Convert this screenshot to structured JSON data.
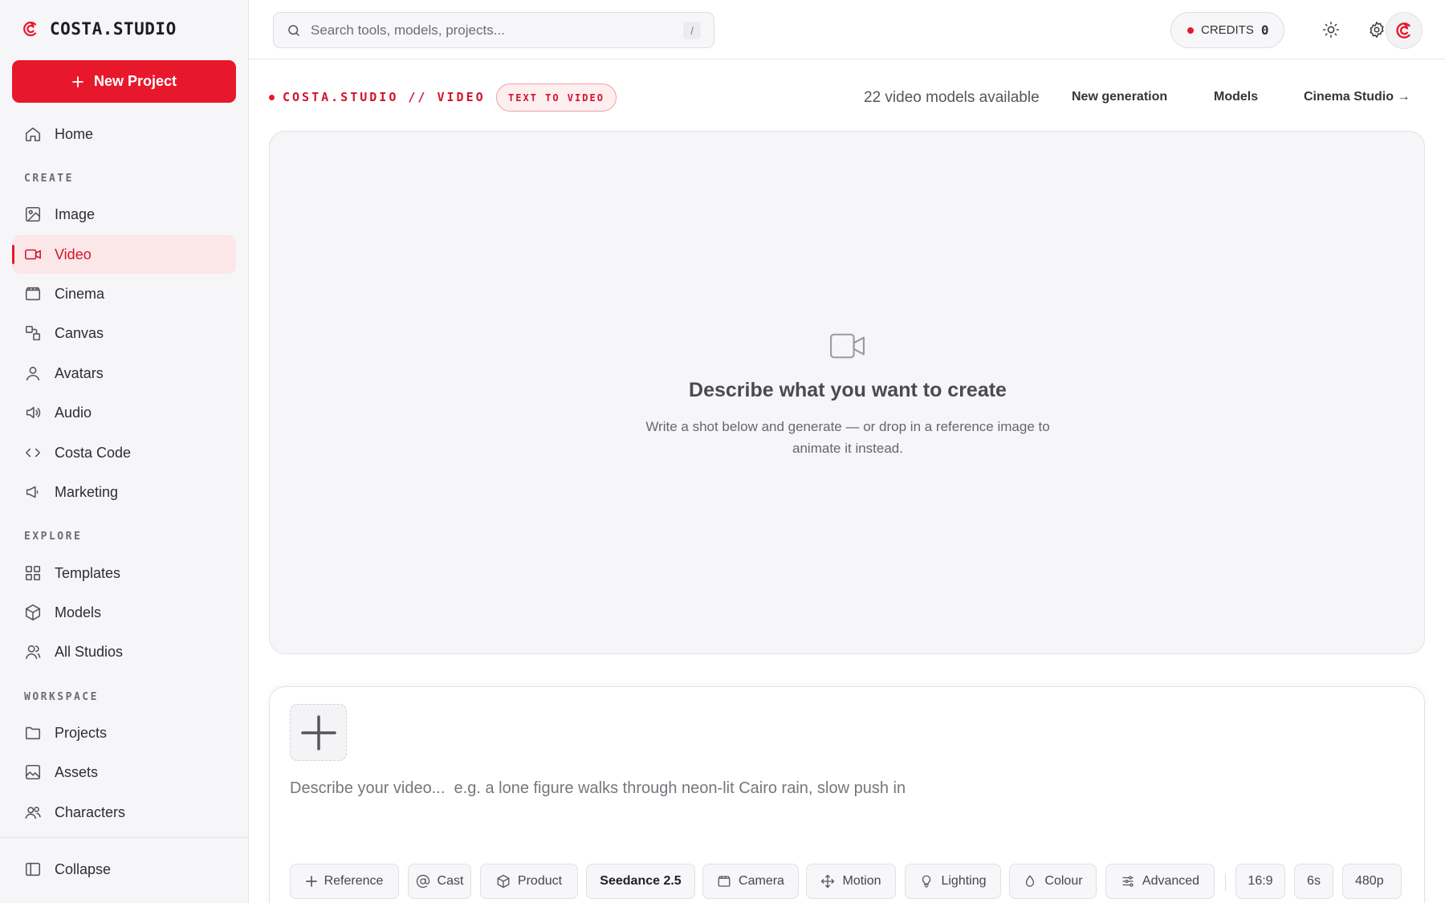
{
  "brand": {
    "name": "COSTA.STUDIO"
  },
  "sidebar": {
    "new_project": "New Project",
    "home": "Home",
    "sections": {
      "create": "CREATE",
      "explore": "EXPLORE",
      "workspace": "WORKSPACE"
    },
    "create_items": [
      "Image",
      "Video",
      "Cinema",
      "Canvas",
      "Avatars",
      "Audio",
      "Costa Code",
      "Marketing"
    ],
    "explore_items": [
      "Templates",
      "Models",
      "All Studios"
    ],
    "workspace_items": [
      "Projects",
      "Assets",
      "Characters"
    ],
    "collapse": "Collapse",
    "active_item": "Video"
  },
  "topbar": {
    "search_placeholder": "Search tools, models, projects...",
    "search_shortcut": "/",
    "credits_label": "CREDITS",
    "credits_value": "0"
  },
  "subheader": {
    "breadcrumb": "COSTA.STUDIO // VIDEO",
    "mode_pill": "TEXT TO VIDEO",
    "models_count": "22 video models available",
    "links": [
      "New generation",
      "Models",
      "Cinema Studio →"
    ]
  },
  "empty_state": {
    "title": "Describe what you want to create",
    "subtitle": "Write a shot below and generate — or drop in a reference image to animate it instead."
  },
  "composer": {
    "prompt_placeholder": "Describe your video...  e.g. a lone figure walks through neon-lit Cairo rain, slow push in",
    "chips": [
      "Reference",
      "Cast",
      "Product",
      "Seedance 2.5",
      "Camera",
      "Motion",
      "Lighting",
      "Colour",
      "Advanced"
    ],
    "settings": [
      "16:9",
      "6s",
      "480p"
    ]
  },
  "colors": {
    "accent": "#e8182c",
    "accent_soft": "#fbe7e8",
    "canvas_bg": "#f6f6f8"
  }
}
